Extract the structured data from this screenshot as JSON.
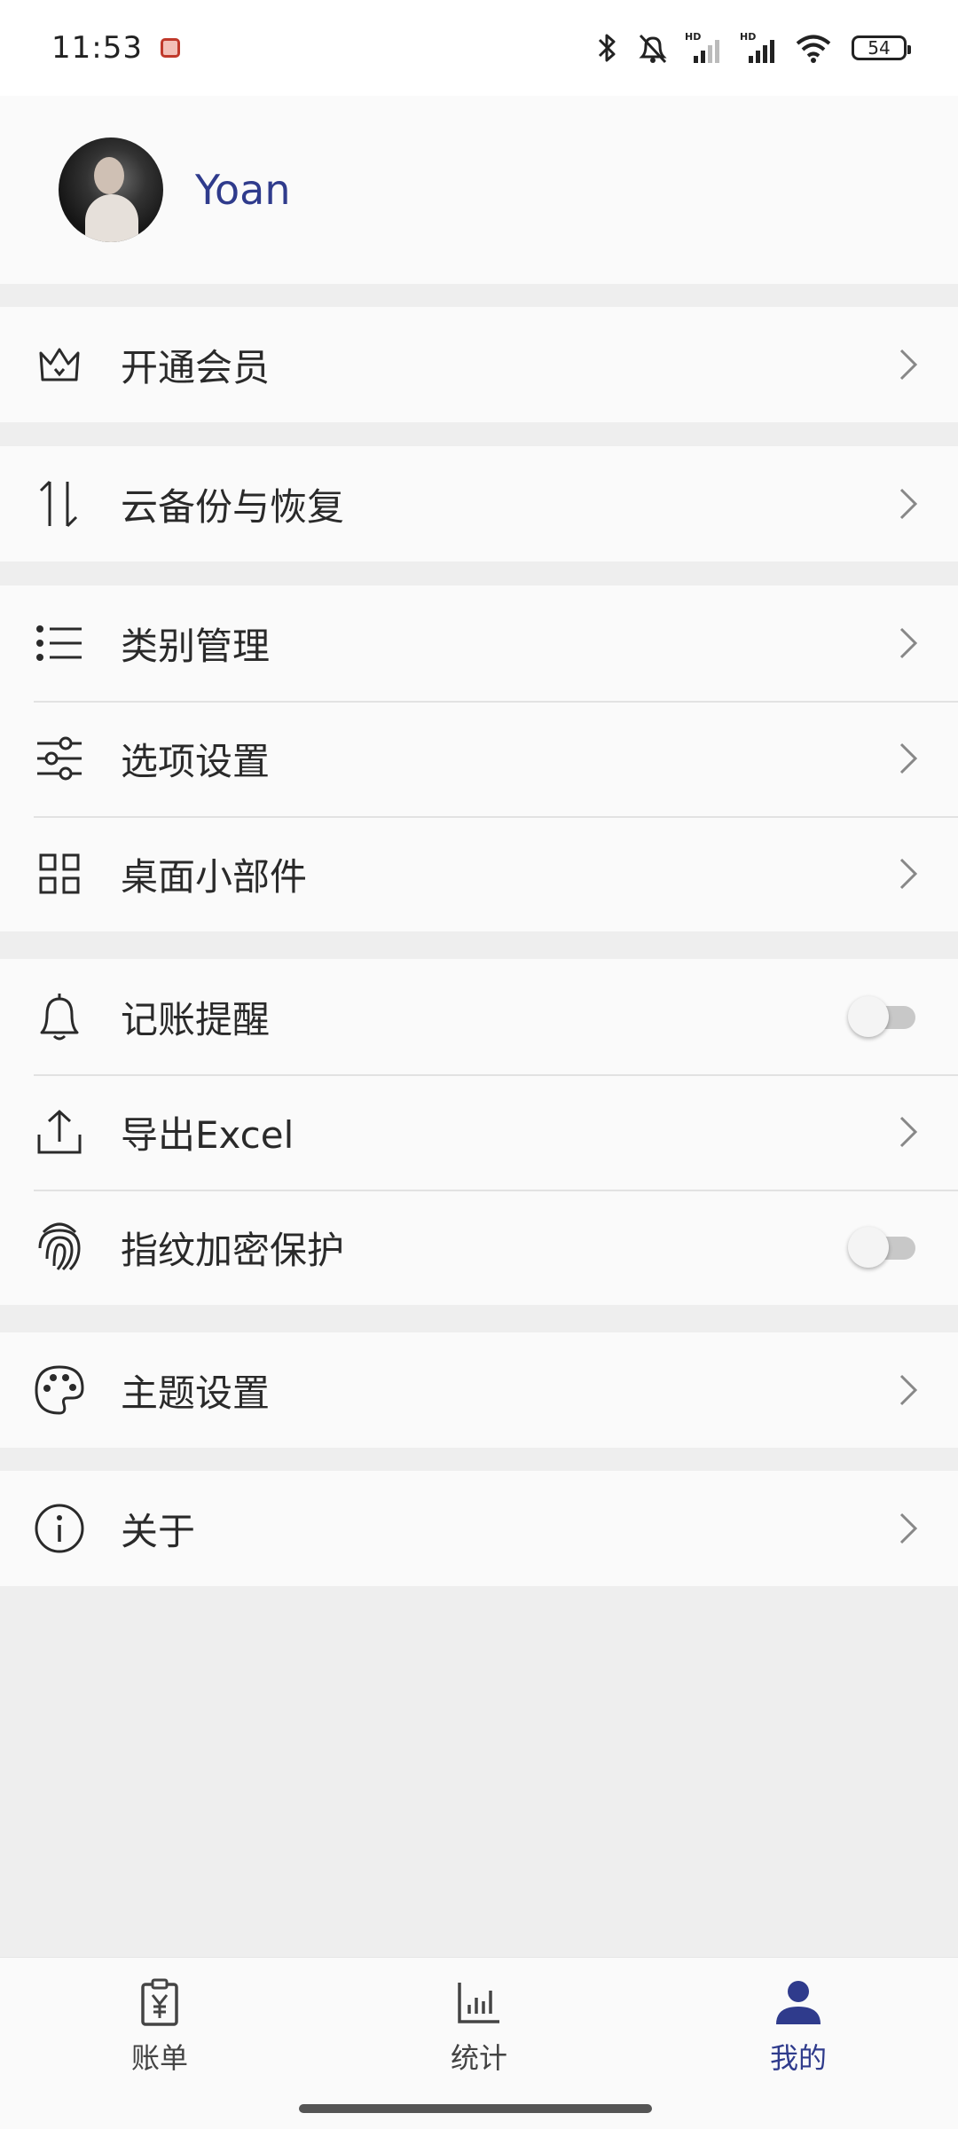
{
  "status_bar": {
    "time": "11:53",
    "battery": "54",
    "icons": [
      "app-notification-icon",
      "bluetooth-icon",
      "alarm-off-icon",
      "hd-signal-icon",
      "hd-signal-icon",
      "wifi-icon",
      "battery-icon"
    ]
  },
  "profile": {
    "name": "Yoan",
    "avatar": "user-avatar"
  },
  "menu": {
    "membership": {
      "label": "开通会员",
      "icon": "crown-icon"
    },
    "cloud_backup": {
      "label": "云备份与恢复",
      "icon": "sync-arrows-icon"
    },
    "category_manage": {
      "label": "类别管理",
      "icon": "list-icon"
    },
    "option_settings": {
      "label": "选项设置",
      "icon": "sliders-icon"
    },
    "widgets": {
      "label": "桌面小部件",
      "icon": "grid-icon"
    },
    "reminder": {
      "label": "记账提醒",
      "icon": "bell-icon",
      "enabled": false
    },
    "export_excel": {
      "label": "导出Excel",
      "icon": "upload-icon"
    },
    "fingerprint": {
      "label": "指纹加密保护",
      "icon": "fingerprint-icon",
      "enabled": false
    },
    "theme": {
      "label": "主题设置",
      "icon": "palette-icon"
    },
    "about": {
      "label": "关于",
      "icon": "info-icon"
    }
  },
  "bottom_nav": {
    "bills": {
      "label": "账单",
      "icon": "bill-icon"
    },
    "stats": {
      "label": "统计",
      "icon": "bar-chart-icon"
    },
    "mine": {
      "label": "我的",
      "icon": "person-icon",
      "active": true
    }
  },
  "colors": {
    "accent": "#2f3b8c",
    "background": "#eeeeee",
    "card": "#fafafa"
  }
}
